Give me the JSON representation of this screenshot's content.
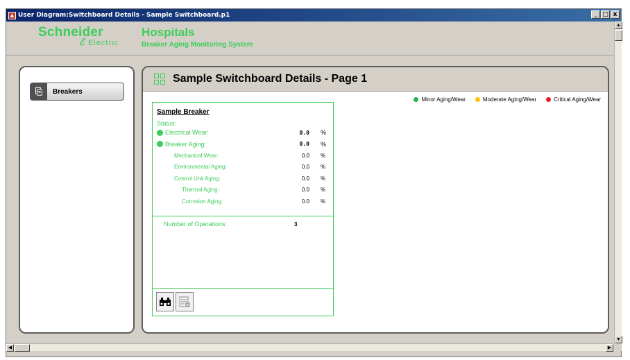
{
  "window": {
    "title": "User Diagram:Switchboard Details - Sample Switchboard.p1",
    "buttons": [
      "_",
      "□",
      "x"
    ]
  },
  "header": {
    "logo_main": "Schneider",
    "logo_sub": "Electric",
    "title": "Hospitals",
    "subtitle": "Breaker Aging Monitoring System"
  },
  "sidebar": {
    "items": [
      {
        "label": "Breakers",
        "icon": "breaker-icon"
      }
    ]
  },
  "main": {
    "title": "Sample Switchboard Details - Page 1",
    "legend": [
      {
        "label": "Minor Aging/Wear",
        "color": "#22b14c"
      },
      {
        "label": "Moderate Aging/Wear",
        "color": "#ffc20e"
      },
      {
        "label": "Critical Aging/Wear",
        "color": "#ed1c24"
      }
    ],
    "card": {
      "name": "Sample Breaker",
      "status_label": "Status:",
      "rows": [
        {
          "label": "Electrical Wear:",
          "value": "0.0",
          "unit": "%"
        },
        {
          "label": "Breaker Aging:",
          "value": "0.0",
          "unit": "%"
        },
        {
          "label": "Mechanical Wear:",
          "value": "0.0",
          "unit": "%"
        },
        {
          "label": "Environmental Aging:",
          "value": "0.0",
          "unit": "%"
        },
        {
          "label": "Control Unit Aging:",
          "value": "0.0",
          "unit": "%"
        },
        {
          "label": "Thermal Aging:",
          "value": "0.0",
          "unit": "%"
        },
        {
          "label": "Corrosion Aging:",
          "value": "0.0",
          "unit": "%"
        }
      ],
      "operations_label": "Number of Operations:",
      "operations_value": "3",
      "tools": [
        "binoculars-icon",
        "details-icon"
      ]
    }
  },
  "colors": {
    "brand_green": "#3dcd58",
    "title_bar": "#0a246a"
  }
}
